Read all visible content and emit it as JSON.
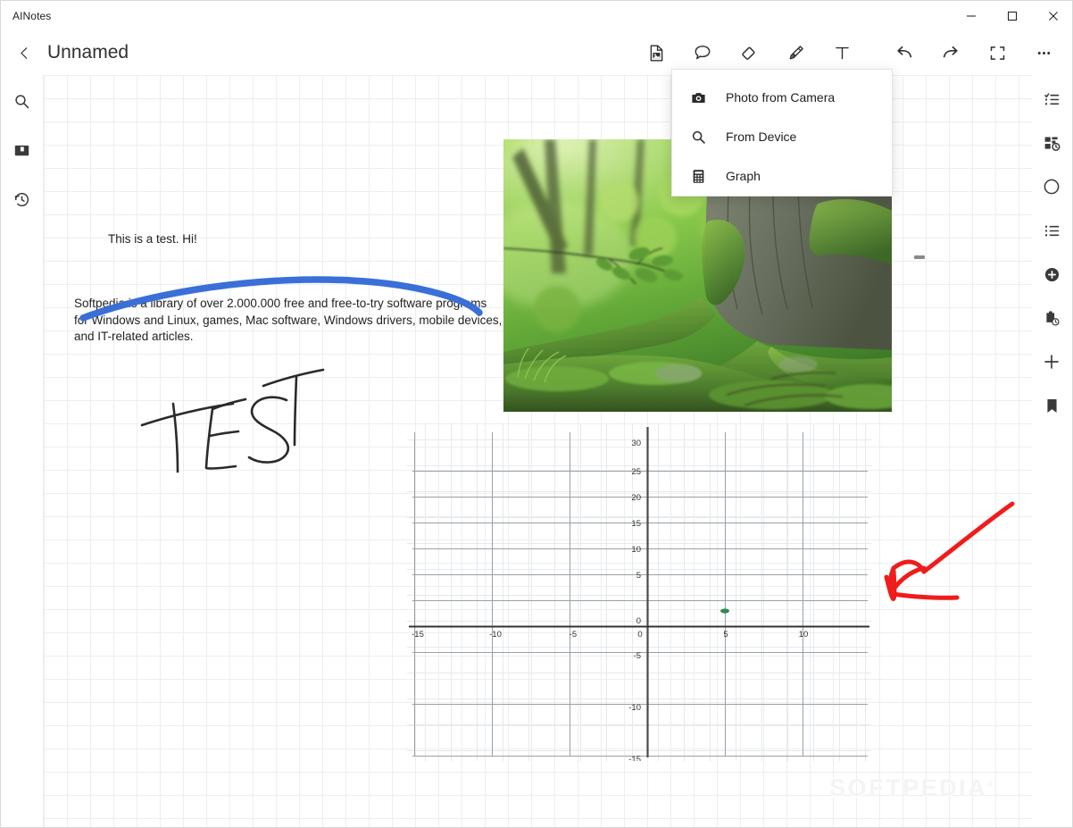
{
  "window": {
    "app_title": "AINotes",
    "controls": [
      {
        "name": "minimize-button",
        "label": "Minimize"
      },
      {
        "name": "maximize-button",
        "label": "Maximize"
      },
      {
        "name": "close-button",
        "label": "Close"
      }
    ]
  },
  "header": {
    "back_label": "Back",
    "page_title": "Unnamed",
    "tools": [
      {
        "name": "insert-media-button",
        "icon": "image-document-icon",
        "label": "Insert"
      },
      {
        "name": "comment-button",
        "icon": "speech-bubble-icon",
        "label": "Comment"
      },
      {
        "name": "eraser-button",
        "icon": "eraser-icon",
        "label": "Eraser"
      },
      {
        "name": "pen-button",
        "icon": "pen-icon",
        "label": "Pen"
      },
      {
        "name": "text-button",
        "icon": "text-t-icon",
        "label": "Text"
      },
      {
        "name": "undo-button",
        "icon": "undo-icon",
        "label": "Undo"
      },
      {
        "name": "redo-button",
        "icon": "redo-icon",
        "label": "Redo"
      },
      {
        "name": "fullscreen-button",
        "icon": "fullscreen-icon",
        "label": "Fullscreen"
      },
      {
        "name": "more-button",
        "icon": "ellipsis-icon",
        "label": "More"
      }
    ]
  },
  "insert_menu": {
    "items": [
      {
        "name": "menu-item-photo-from-camera",
        "icon": "camera-icon",
        "label": "Photo from Camera"
      },
      {
        "name": "menu-item-from-device",
        "icon": "search-icon",
        "label": "From Device"
      },
      {
        "name": "menu-item-graph",
        "icon": "calculator-icon",
        "label": "Graph"
      }
    ]
  },
  "left_rail": {
    "items": [
      {
        "name": "sidebar-item-search",
        "icon": "search-icon",
        "label": "Search"
      },
      {
        "name": "sidebar-item-notebook",
        "icon": "notebook-icon",
        "label": "Notebook"
      },
      {
        "name": "sidebar-item-history",
        "icon": "history-clock-icon",
        "label": "History"
      }
    ]
  },
  "right_rail": {
    "items": [
      {
        "name": "sidebar-item-checklist",
        "icon": "checklist-icon",
        "label": "Checklist"
      },
      {
        "name": "sidebar-item-layout-recent",
        "icon": "layout-clock-icon",
        "label": "Recent layouts"
      },
      {
        "name": "sidebar-item-shape-circle",
        "icon": "circle-icon",
        "label": "Circle shape"
      },
      {
        "name": "sidebar-item-bullet-list",
        "icon": "bullet-list-icon",
        "label": "Bullet list"
      },
      {
        "name": "sidebar-item-add-filled",
        "icon": "plus-circle-filled-icon",
        "label": "Add"
      },
      {
        "name": "sidebar-item-clipboard-recent",
        "icon": "clipboard-clock-icon",
        "label": "Clipboard history"
      },
      {
        "name": "sidebar-item-add",
        "icon": "plus-icon",
        "label": "New"
      },
      {
        "name": "sidebar-item-bookmark",
        "icon": "bookmark-filled-icon",
        "label": "Bookmark"
      }
    ]
  },
  "canvas": {
    "note_one": "This is a test. Hi!",
    "note_two": "Softpedia is a library of over 2.000.000 free and free-to-try software programs for Windows and Linux, games, Mac software, Windows drivers, mobile devices, and IT-related articles.",
    "handwriting": "TEST",
    "ink_colors": {
      "blue_stroke": "#3a6fd8",
      "black_stroke": "#2a2a2a",
      "red_arrow": "#f01c1c"
    },
    "photo": {
      "name": "forest-photo",
      "alt": "Forest floor with mossy tree roots and green foliage"
    },
    "watermark": "SOFTPEDIA",
    "watermark_mark": "®"
  },
  "chart_data": {
    "type": "scatter",
    "title": "",
    "xlabel": "",
    "ylabel": "",
    "xlim": [
      -17,
      13
    ],
    "ylim": [
      -17,
      31
    ],
    "grid": true,
    "legend": "none",
    "x_ticks": [
      "-15",
      "-10",
      "-5",
      "0",
      "5",
      "10"
    ],
    "y_ticks": [
      "30",
      "25",
      "20",
      "15",
      "10",
      "5",
      "0",
      "-5",
      "-10",
      "-15"
    ],
    "x_tick_values": [
      -15,
      -10,
      -5,
      0,
      5,
      10
    ],
    "y_tick_values": [
      30,
      25,
      20,
      15,
      10,
      5,
      0,
      -5,
      -10,
      -15
    ],
    "series": [
      {
        "name": "point",
        "color": "#2e8b4f",
        "points": [
          {
            "x": 5,
            "y": 3
          }
        ]
      }
    ]
  }
}
